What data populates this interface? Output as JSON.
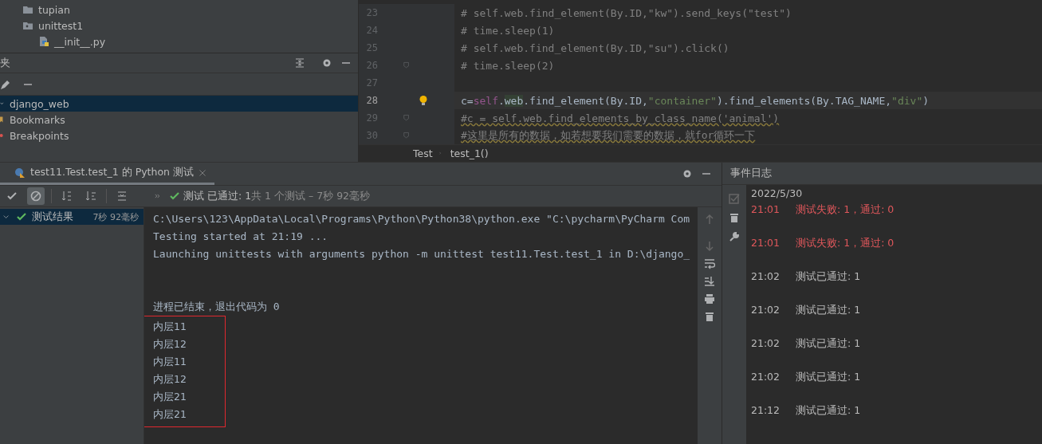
{
  "project_tree": {
    "items": [
      {
        "label": "tupian",
        "kind": "folder"
      },
      {
        "label": "unittest1",
        "kind": "package",
        "children": [
          {
            "label": "__init__.py",
            "kind": "python"
          }
        ]
      }
    ]
  },
  "bookmarks_panel": {
    "title": "夹",
    "items": [
      {
        "label": "django_web",
        "kind": "project",
        "selected": true
      },
      {
        "label": "Bookmarks",
        "kind": "bookmark",
        "selected": false
      },
      {
        "label": "Breakpoints",
        "kind": "breakpoint",
        "selected": false
      }
    ]
  },
  "editor": {
    "lines": [
      {
        "number": "23",
        "current": false,
        "fold": false,
        "bulb": false,
        "tokens": [
          {
            "text": "# self.web.find_element(By.ID,\"kw\").send_keys(\"test\")",
            "kind": "comment"
          }
        ]
      },
      {
        "number": "24",
        "current": false,
        "fold": false,
        "bulb": false,
        "tokens": [
          {
            "text": "# time.sleep(1)",
            "kind": "comment"
          }
        ]
      },
      {
        "number": "25",
        "current": false,
        "fold": false,
        "bulb": false,
        "tokens": [
          {
            "text": "# self.web.find_element(By.ID,\"su\").click()",
            "kind": "comment"
          }
        ]
      },
      {
        "number": "26",
        "current": false,
        "fold": true,
        "bulb": false,
        "tokens": [
          {
            "text": "# time.sleep(2)",
            "kind": "comment"
          }
        ]
      },
      {
        "number": "27",
        "current": false,
        "fold": false,
        "bulb": false
      },
      {
        "number": "28",
        "current": true,
        "fold": false,
        "bulb": true,
        "tokens": [
          {
            "text": "c=",
            "kind": "plain"
          },
          {
            "text": "self",
            "kind": "self"
          },
          {
            "text": ".",
            "kind": "plain"
          },
          {
            "text": "web",
            "kind": "field"
          },
          {
            "text": ".find_element(By.ID,",
            "kind": "plain"
          },
          {
            "text": "\"container\"",
            "kind": "string"
          },
          {
            "text": ").find_elements(By.TAG_NAME,",
            "kind": "plain"
          },
          {
            "text": "\"div\"",
            "kind": "string"
          },
          {
            "text": ")",
            "kind": "plain"
          }
        ]
      },
      {
        "number": "29",
        "current": false,
        "fold": true,
        "bulb": false,
        "tokens": [
          {
            "text": "#c = self.web.find_elements_by_class_name('animal')",
            "kind": "comment_warn"
          }
        ]
      },
      {
        "number": "30",
        "current": false,
        "fold": true,
        "bulb": false,
        "tokens": [
          {
            "text": "#这里是所有的数据，如若想要我们需要的数据，就for循环一下",
            "kind": "comment_warn"
          }
        ]
      }
    ],
    "breadcrumbs": [
      "Test",
      "test_1()"
    ]
  },
  "run_panel": {
    "tab": {
      "label": "test11.Test.test_1 的 Python 测试",
      "selected": true
    },
    "status": {
      "passed": "测试 已通过: 1",
      "summary": "共 1 个测试 – 7秒 92毫秒"
    },
    "tree": [
      {
        "label": "测试结果",
        "duration": "7秒 92毫秒",
        "selected": true
      }
    ],
    "console": {
      "lines": [
        "C:\\Users\\123\\AppData\\Local\\Programs\\Python\\Python38\\python.exe \"C:\\pycharm\\PyCharm Com",
        "Testing started at 21:19 ...",
        "Launching unittests with arguments python -m unittest test11.Test.test_1 in D:\\django_"
      ],
      "exit_line": "进程已结束，退出代码为 0",
      "boxed_lines": [
        "内层11",
        "内层12",
        "内层11",
        "内层12",
        "内层21",
        "内层21"
      ]
    }
  },
  "event_log": {
    "title": "事件日志",
    "date": "2022/5/30",
    "entries": [
      {
        "time": "21:01",
        "message": "测试失败: 1，通过: 0",
        "error": true
      },
      {
        "time": "21:01",
        "message": "测试失败: 1，通过: 0",
        "error": true
      },
      {
        "time": "21:02",
        "message": "测试已通过: 1",
        "error": false
      },
      {
        "time": "21:02",
        "message": "测试已通过: 1",
        "error": false
      },
      {
        "time": "21:02",
        "message": "测试已通过: 1",
        "error": false
      },
      {
        "time": "21:02",
        "message": "测试已通过: 1",
        "error": false
      },
      {
        "time": "21:12",
        "message": "测试已通过: 1",
        "error": false
      }
    ]
  }
}
